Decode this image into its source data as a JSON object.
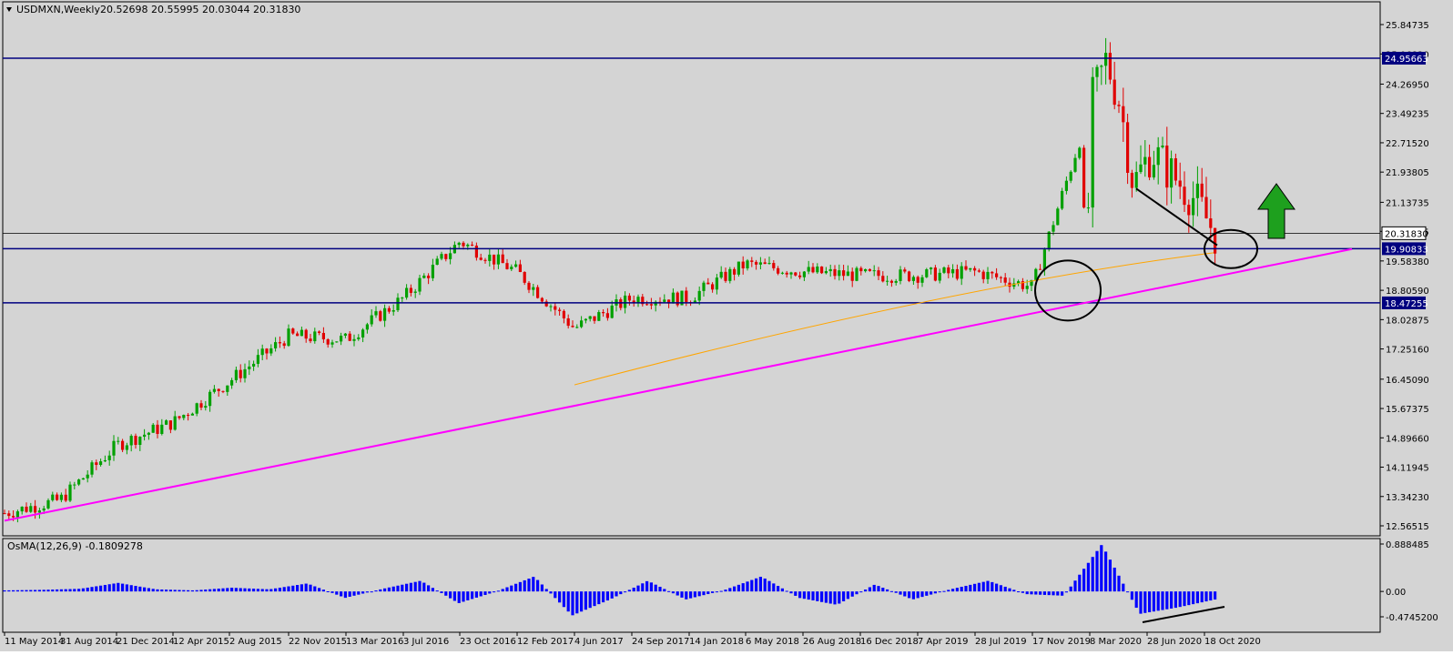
{
  "header": {
    "title": "USDMXN,Weekly",
    "ohlc": "20.52698 20.55995 20.03044 20.31830"
  },
  "indicator": {
    "title": "OsMA(12,26,9) -0.1809278",
    "yticks": [
      "0.888485",
      "0.00",
      "-0.4745200"
    ],
    "yticks_values": [
      0.888485,
      0.0,
      -0.47452
    ]
  },
  "colors": {
    "background": "#d4d4d4",
    "bull": "#00a000",
    "bear": "#e00000",
    "hline": "#00007f",
    "trendline": "#ff00ff",
    "ma": "#ffa500",
    "osma": "#0000ff",
    "arrow": "#1ea01e"
  },
  "chart_data": {
    "type": "candlestick",
    "symbol": "USDMXN",
    "timeframe": "Weekly",
    "ylim": [
      12.56515,
      25.84735
    ],
    "yticks": [
      25.84735,
      25.0682,
      24.2695,
      23.49235,
      22.7152,
      21.93805,
      21.13735,
      20.36725,
      19.5838,
      18.8059,
      18.02875,
      17.2516,
      16.4509,
      15.67375,
      14.8966,
      14.11945,
      13.3423,
      12.56515
    ],
    "ytick_labels": [
      "25.84735",
      "25.06820",
      "24.26950",
      "23.49235",
      "22.71520",
      "21.93805",
      "21.13735",
      "20.36725",
      "19.58380",
      "18.80590",
      "18.02875",
      "17.25160",
      "16.45090",
      "15.67375",
      "14.89660",
      "14.11945",
      "13.34230",
      "12.56515"
    ],
    "price_labels": [
      {
        "label": "24.95663",
        "value": 24.95663,
        "kind": "hline"
      },
      {
        "label": "20.31830",
        "value": 20.3183,
        "kind": "current"
      },
      {
        "label": "19.90833",
        "value": 19.90833,
        "kind": "hline"
      },
      {
        "label": "18.47255",
        "value": 18.47255,
        "kind": "hline"
      }
    ],
    "x_labels": [
      "11 May 2014",
      "31 Aug 2014",
      "21 Dec 2014",
      "12 Apr 2015",
      "2 Aug 2015",
      "22 Nov 2015",
      "13 Mar 2016",
      "3 Jul 2016",
      "23 Oct 2016",
      "12 Feb 2017",
      "4 Jun 2017",
      "24 Sep 2017",
      "14 Jan 2018",
      "6 May 2018",
      "26 Aug 2018",
      "16 Dec 2018",
      "7 Apr 2019",
      "28 Jul 2019",
      "17 Nov 2019",
      "8 Mar 2020",
      "28 Jun 2020",
      "18 Oct 2020"
    ],
    "close_path_anchors": [
      [
        "11 May 2014",
        12.9
      ],
      [
        "31 Aug 2014",
        13.25
      ],
      [
        "21 Dec 2014",
        14.7
      ],
      [
        "12 Apr 2015",
        15.3
      ],
      [
        "2 Aug 2015",
        16.4
      ],
      [
        "22 Nov 2015",
        17.6
      ],
      [
        "13 Mar 2016",
        17.5
      ],
      [
        "3 Jul 2016",
        18.6
      ],
      [
        "23 Oct 2016",
        20.1
      ],
      [
        "12 Feb 2017",
        19.3
      ],
      [
        "4 Jun 2017",
        17.8
      ],
      [
        "24 Sep 2017",
        18.6
      ],
      [
        "14 Jan 2018",
        18.6
      ],
      [
        "6 May 2018",
        19.5
      ],
      [
        "26 Aug 2018",
        19.3
      ],
      [
        "16 Dec 2018",
        19.2
      ],
      [
        "7 Apr 2019",
        19.2
      ],
      [
        "28 Jul 2019",
        19.3
      ],
      [
        "17 Nov 2019",
        18.9
      ],
      [
        "8 Mar 2020",
        24.0
      ],
      [
        "28 Jun 2020",
        22.4
      ],
      [
        "18 Oct 2020",
        20.3
      ]
    ],
    "moving_average": {
      "start": [
        "4 Jun 2017",
        16.3
      ],
      "end": [
        "18 Oct 2020",
        19.8
      ]
    },
    "trendline": {
      "start": [
        "11 May 2014",
        12.7
      ],
      "end": [
        "18 Oct 2020",
        19.9
      ]
    },
    "grid": false,
    "osma_values": [
      0.02,
      0.03,
      0.05,
      0.16,
      0.04,
      0.02,
      0.07,
      0.04,
      0.15,
      -0.12,
      0.05,
      0.2,
      -0.22,
      0.0,
      0.28,
      -0.45,
      -0.15,
      0.2,
      -0.15,
      0.02,
      0.28,
      -0.12,
      -0.25,
      0.13,
      -0.15,
      0.04,
      0.2,
      -0.05,
      -0.08,
      0.88,
      -0.42,
      -0.3,
      -0.15
    ]
  }
}
